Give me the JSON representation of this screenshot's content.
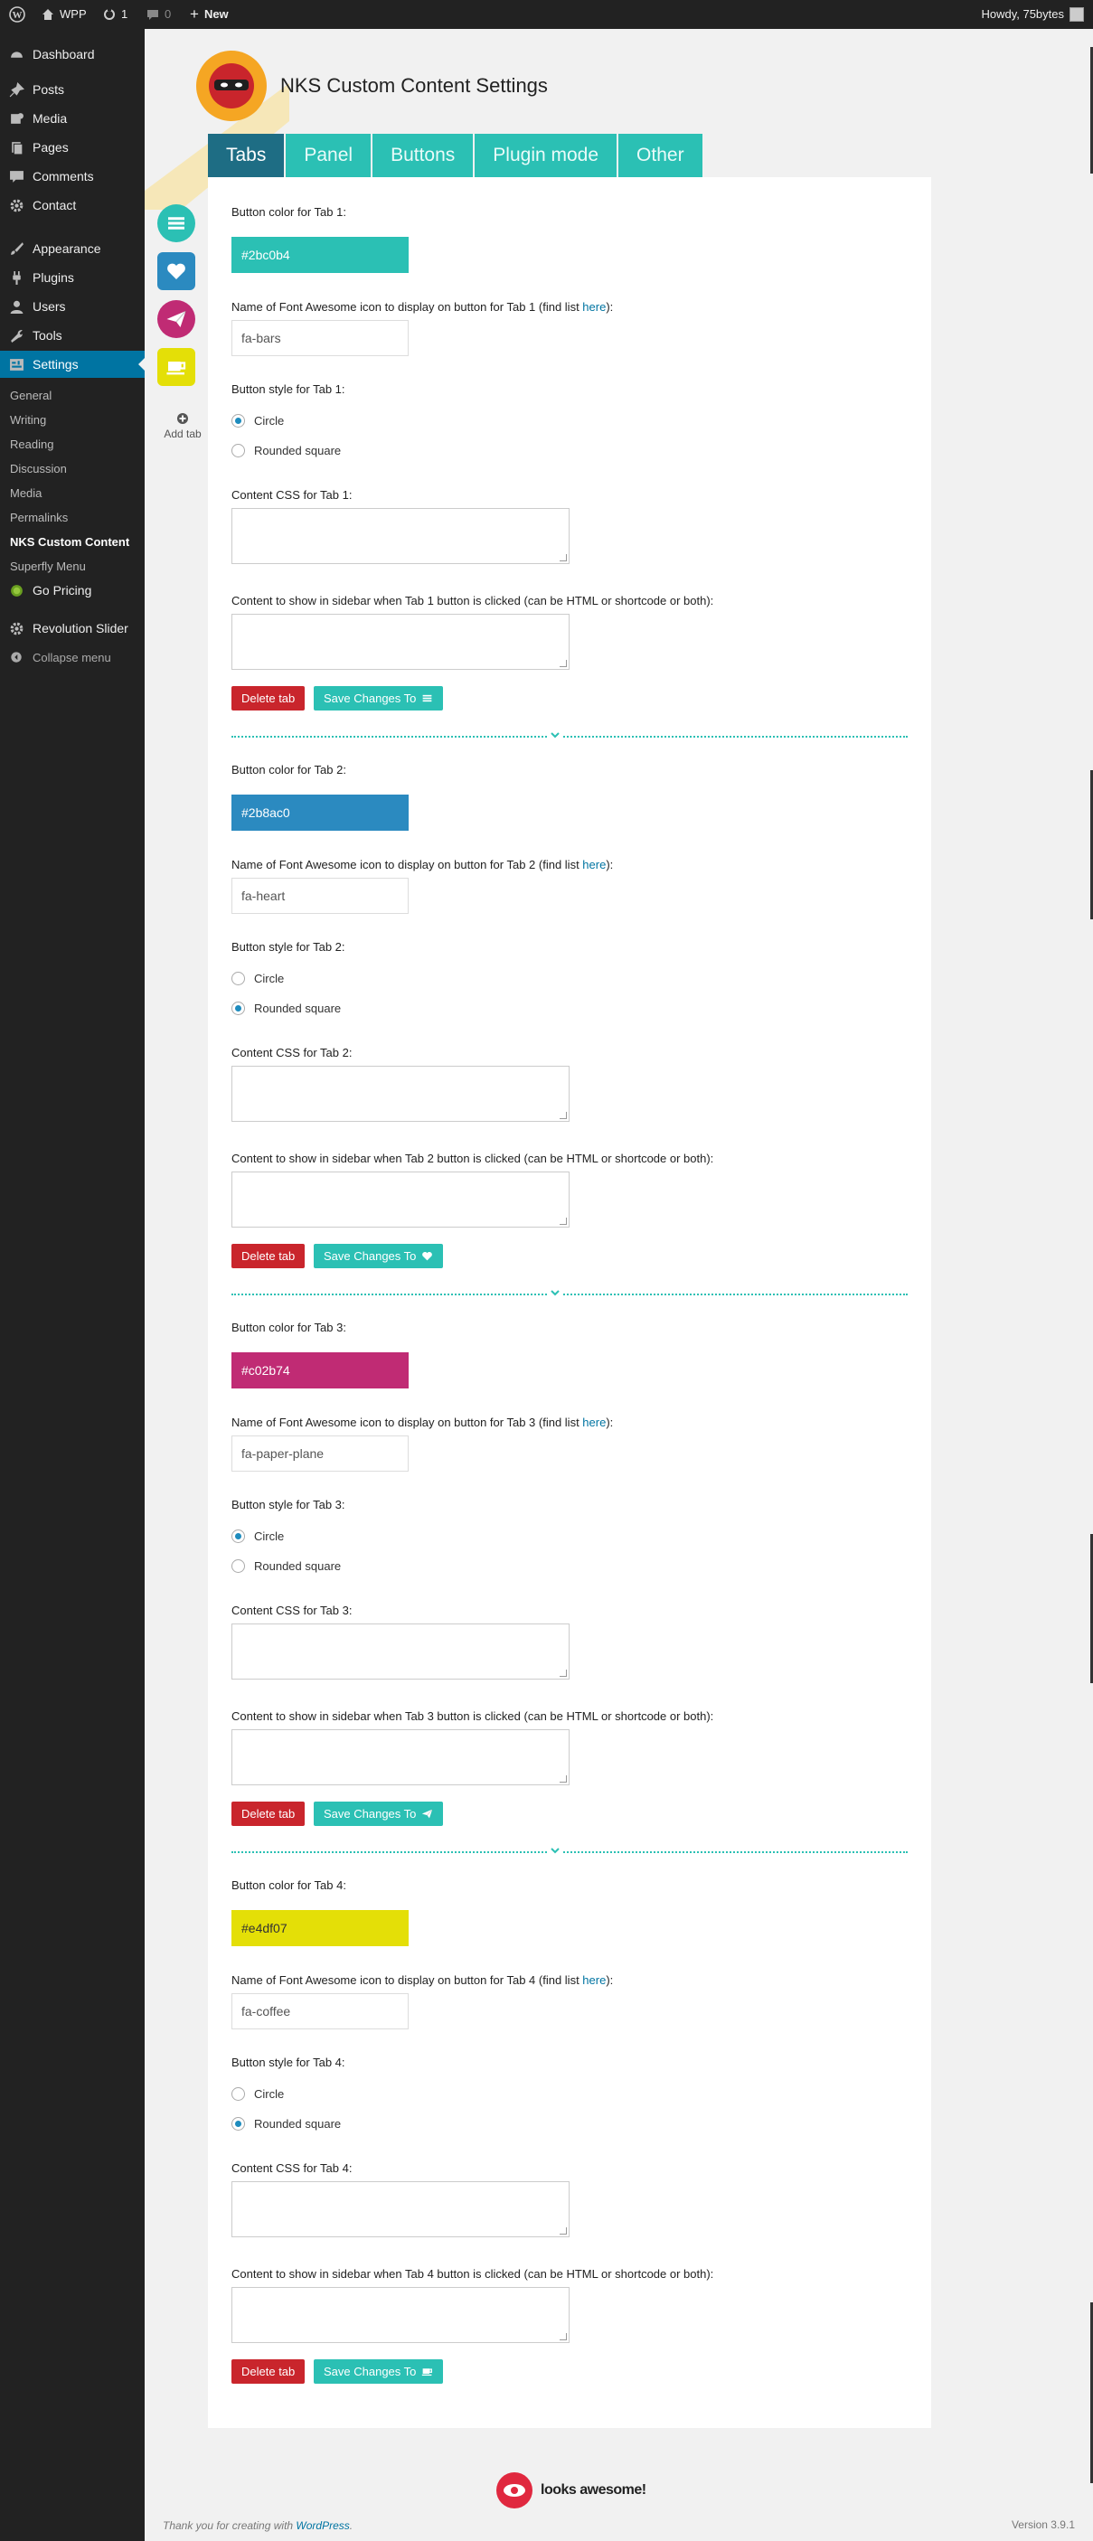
{
  "adminbar": {
    "site": "WPP",
    "updates": "1",
    "comments": "0",
    "new": "New",
    "howdy": "Howdy, 75bytes"
  },
  "menu": [
    {
      "label": "Dashboard",
      "icon": "dashboard-icon"
    },
    {
      "label": "Posts",
      "icon": "pin-icon"
    },
    {
      "label": "Media",
      "icon": "media-icon"
    },
    {
      "label": "Pages",
      "icon": "pages-icon"
    },
    {
      "label": "Comments",
      "icon": "comment-icon"
    },
    {
      "label": "Contact",
      "icon": "gear-icon"
    },
    {
      "label": "Appearance",
      "icon": "brush-icon"
    },
    {
      "label": "Plugins",
      "icon": "plug-icon"
    },
    {
      "label": "Users",
      "icon": "user-icon"
    },
    {
      "label": "Tools",
      "icon": "wrench-icon"
    },
    {
      "label": "Settings",
      "icon": "settings-icon"
    },
    {
      "label": "Go Pricing",
      "icon": "circle-icon"
    },
    {
      "label": "Revolution Slider",
      "icon": "gear-icon"
    },
    {
      "label": "Collapse menu",
      "icon": "collapse-icon"
    }
  ],
  "submenu": [
    "General",
    "Writing",
    "Reading",
    "Discussion",
    "Media",
    "Permalinks",
    "NKS Custom Content",
    "Superfly Menu"
  ],
  "page": {
    "title": "NKS Custom Content Settings",
    "add_tab": "Add tab"
  },
  "tabs": [
    "Tabs",
    "Panel",
    "Buttons",
    "Plugin mode",
    "Other"
  ],
  "rail": [
    {
      "color": "#2bc0b4",
      "shape": "circle",
      "icon": "bars-icon"
    },
    {
      "color": "#2b8ac0",
      "shape": "rounded",
      "icon": "heart-icon"
    },
    {
      "color": "#c02b74",
      "shape": "circle",
      "icon": "paper-plane-icon"
    },
    {
      "color": "#e4df07",
      "shape": "rounded",
      "icon": "coffee-icon"
    }
  ],
  "link_text": "here",
  "sections": [
    {
      "color_label": "Button color for Tab 1:",
      "color": "#2bc0b4",
      "color_text": "#2bc0b4",
      "icon_label_pre": "Name of Font Awesome icon to display on button for Tab 1 (find list ",
      "icon_label_post": "):",
      "icon_value": "fa-bars",
      "style_label": "Button style for Tab 1:",
      "style": "circle",
      "css_label": "Content CSS for Tab 1:",
      "content_label": "Content to show in sidebar when Tab 1 button is clicked (can be HTML or shortcode or both):",
      "delete": "Delete tab",
      "save": "Save Changes To",
      "save_icon": "bars-icon"
    },
    {
      "color_label": "Button color for Tab 2:",
      "color": "#2b8ac0",
      "color_text": "#2b8ac0",
      "icon_label_pre": "Name of Font Awesome icon to display on button for Tab 2 (find list ",
      "icon_label_post": "):",
      "icon_value": "fa-heart",
      "style_label": "Button style for Tab 2:",
      "style": "rounded",
      "css_label": "Content CSS for Tab 2:",
      "content_label": "Content to show in sidebar when Tab 2 button is clicked (can be HTML or shortcode or both):",
      "delete": "Delete tab",
      "save": "Save Changes To",
      "save_icon": "heart-icon"
    },
    {
      "color_label": "Button color for Tab 3:",
      "color": "#c02b74",
      "color_text": "#c02b74",
      "icon_label_pre": "Name of Font Awesome icon to display on button for Tab 3 (find list ",
      "icon_label_post": "):",
      "icon_value": "fa-paper-plane",
      "style_label": "Button style for Tab 3:",
      "style": "circle",
      "css_label": "Content CSS for Tab 3:",
      "content_label": "Content to show in sidebar when Tab 3 button is clicked (can be HTML or shortcode or both):",
      "delete": "Delete tab",
      "save": "Save Changes To",
      "save_icon": "paper-plane-icon"
    },
    {
      "color_label": "Button color for Tab 4:",
      "color": "#e4df07",
      "color_text": "#e4df07",
      "icon_label_pre": "Name of Font Awesome icon to display on button for Tab 4 (find list ",
      "icon_label_post": "):",
      "icon_value": "fa-coffee",
      "style_label": "Button style for Tab 4:",
      "style": "rounded",
      "css_label": "Content CSS for Tab 4:",
      "content_label": "Content to show in sidebar when Tab 4 button is clicked (can be HTML or shortcode or both):",
      "delete": "Delete tab",
      "save": "Save Changes To",
      "save_icon": "coffee-icon"
    }
  ],
  "radio_labels": {
    "circle": "Circle",
    "rounded": "Rounded square"
  },
  "brand": "looks awesome!",
  "footer": {
    "text_pre": "Thank you for creating with ",
    "link": "WordPress",
    "text_post": ".",
    "version": "Version 3.9.1"
  }
}
